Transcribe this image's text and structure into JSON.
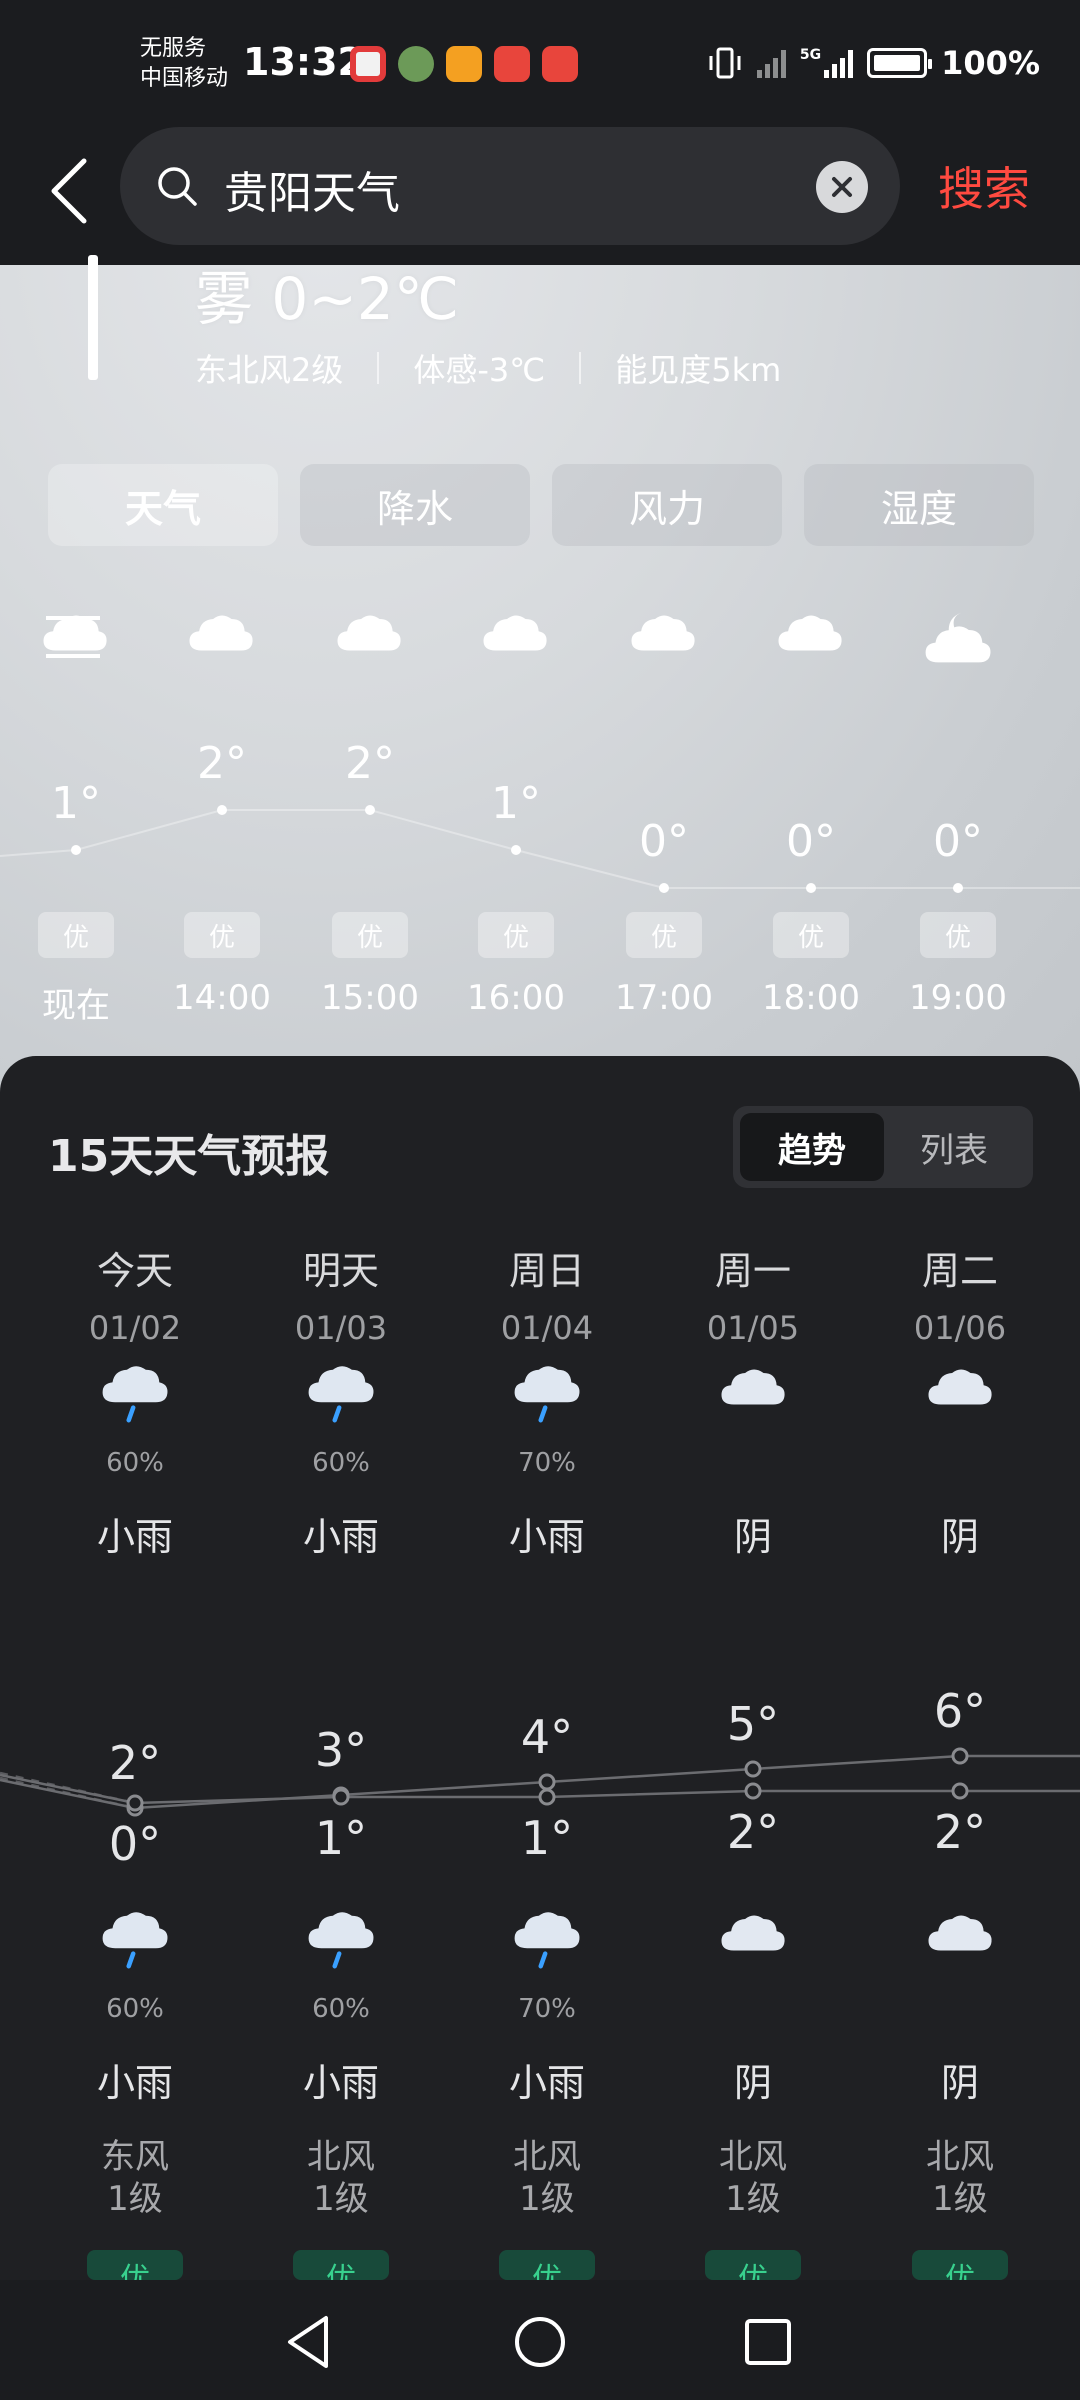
{
  "status_bar": {
    "carrier_line1": "无服务",
    "carrier_line2": "中国移动",
    "time": "13:32",
    "battery": "100%",
    "network": "5G"
  },
  "search": {
    "query": "贵阳天气",
    "action_label": "搜索"
  },
  "current": {
    "condition_temp": "雾  0~2℃",
    "wind": "东北风2级",
    "feels_like": "体感-3℃",
    "visibility": "能见度5km"
  },
  "tabs": [
    {
      "label": "天气",
      "active": true
    },
    {
      "label": "降水",
      "active": false
    },
    {
      "label": "风力",
      "active": false
    },
    {
      "label": "湿度",
      "active": false
    }
  ],
  "hourly": [
    {
      "time": "现在",
      "temp": "1°",
      "temp_value": 1,
      "aqi": "优",
      "icon": "cloud-icon"
    },
    {
      "time": "14:00",
      "temp": "2°",
      "temp_value": 2,
      "aqi": "优",
      "icon": "cloud-icon"
    },
    {
      "time": "15:00",
      "temp": "2°",
      "temp_value": 2,
      "aqi": "优",
      "icon": "cloud-icon"
    },
    {
      "time": "16:00",
      "temp": "1°",
      "temp_value": 1,
      "aqi": "优",
      "icon": "cloud-icon"
    },
    {
      "time": "17:00",
      "temp": "0°",
      "temp_value": 0,
      "aqi": "优",
      "icon": "cloud-icon"
    },
    {
      "time": "18:00",
      "temp": "0°",
      "temp_value": 0,
      "aqi": "优",
      "icon": "cloud-icon"
    },
    {
      "time": "19:00",
      "temp": "0°",
      "temp_value": 0,
      "aqi": "优",
      "icon": "cloud-moon-icon"
    }
  ],
  "forecast": {
    "title": "15天天气预报",
    "toggle": [
      {
        "label": "趋势",
        "active": true
      },
      {
        "label": "列表",
        "active": false
      }
    ],
    "days": [
      {
        "name": "今天",
        "date": "01/02",
        "day_icon": "rain-cloud-icon",
        "day_pop": "60%",
        "day_cond": "小雨",
        "high": "2°",
        "high_value": 2,
        "low": "0°",
        "low_value": 0,
        "night_icon": "rain-cloud-icon",
        "night_pop": "60%",
        "night_cond": "小雨",
        "wind_dir": "东风",
        "wind_level": "1级",
        "aqi": "优"
      },
      {
        "name": "明天",
        "date": "01/03",
        "day_icon": "rain-cloud-icon",
        "day_pop": "60%",
        "day_cond": "小雨",
        "high": "3°",
        "high_value": 3,
        "low": "1°",
        "low_value": 1,
        "night_icon": "rain-cloud-icon",
        "night_pop": "60%",
        "night_cond": "小雨",
        "wind_dir": "北风",
        "wind_level": "1级",
        "aqi": "优"
      },
      {
        "name": "周日",
        "date": "01/04",
        "day_icon": "rain-cloud-icon",
        "day_pop": "70%",
        "day_cond": "小雨",
        "high": "4°",
        "high_value": 4,
        "low": "1°",
        "low_value": 1,
        "night_icon": "rain-cloud-icon",
        "night_pop": "70%",
        "night_cond": "小雨",
        "wind_dir": "北风",
        "wind_level": "1级",
        "aqi": "优"
      },
      {
        "name": "周一",
        "date": "01/05",
        "day_icon": "cloud-icon",
        "day_pop": "",
        "day_cond": "阴",
        "high": "5°",
        "high_value": 5,
        "low": "2°",
        "low_value": 2,
        "night_icon": "cloud-icon",
        "night_pop": "",
        "night_cond": "阴",
        "wind_dir": "北风",
        "wind_level": "1级",
        "aqi": "优"
      },
      {
        "name": "周二",
        "date": "01/06",
        "day_icon": "cloud-icon",
        "day_pop": "",
        "day_cond": "阴",
        "high": "6°",
        "high_value": 6,
        "low": "2°",
        "low_value": 2,
        "night_icon": "cloud-icon",
        "night_pop": "",
        "night_cond": "阴",
        "wind_dir": "北风",
        "wind_level": "1级",
        "aqi": "优"
      }
    ]
  },
  "colors": {
    "accent_red": "#ff4a40",
    "aqi_green": "#38d18e",
    "rain_blue": "#3aa0ff"
  }
}
